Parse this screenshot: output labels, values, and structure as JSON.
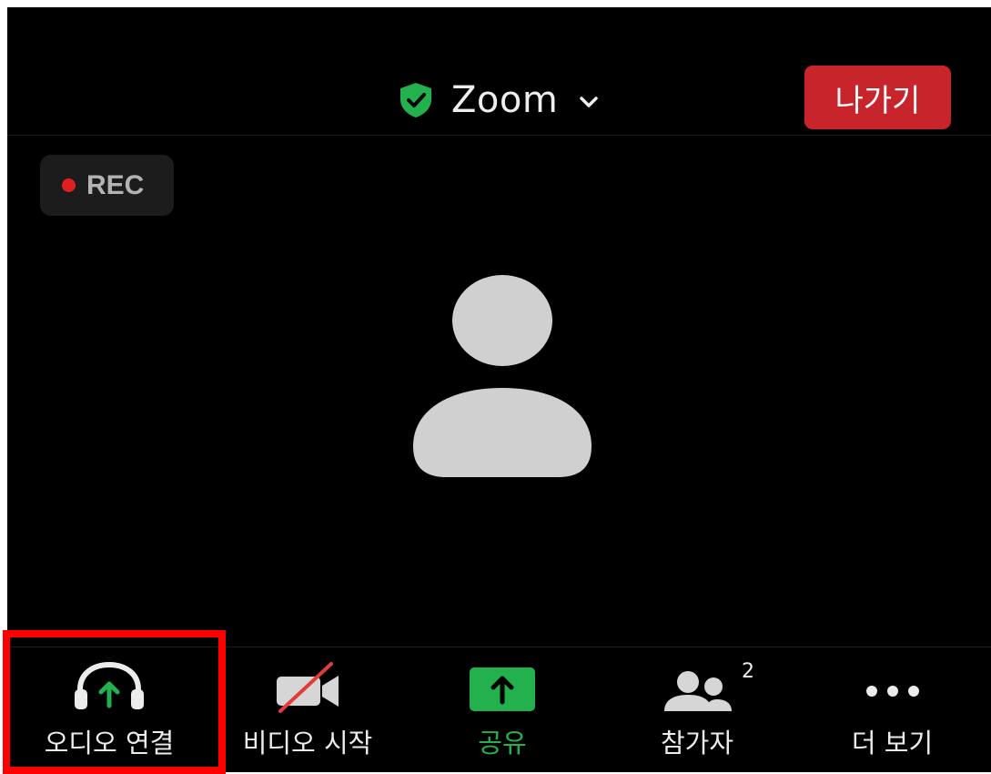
{
  "header": {
    "title": "Zoom",
    "leave_label": "나가기",
    "title_icon": "shield-check-icon",
    "dropdown_icon": "chevron-down-icon"
  },
  "rec_badge": {
    "label": "REC"
  },
  "participant": {
    "icon": "person-placeholder-icon"
  },
  "toolbar": {
    "items": [
      {
        "label": "오디오 연결",
        "icon": "headphones-icon"
      },
      {
        "label": "비디오 시작",
        "icon": "video-off-icon"
      },
      {
        "label": "공유",
        "icon": "share-screen-icon"
      },
      {
        "label": "참가자",
        "icon": "participants-icon",
        "count": "2"
      },
      {
        "label": "더 보기",
        "icon": "more-icon"
      }
    ]
  },
  "colors": {
    "background": "#000000",
    "leave_button": "#c8242b",
    "accent_green": "#22b14c",
    "rec_dot": "#e02020",
    "highlight": "#ff0000"
  }
}
